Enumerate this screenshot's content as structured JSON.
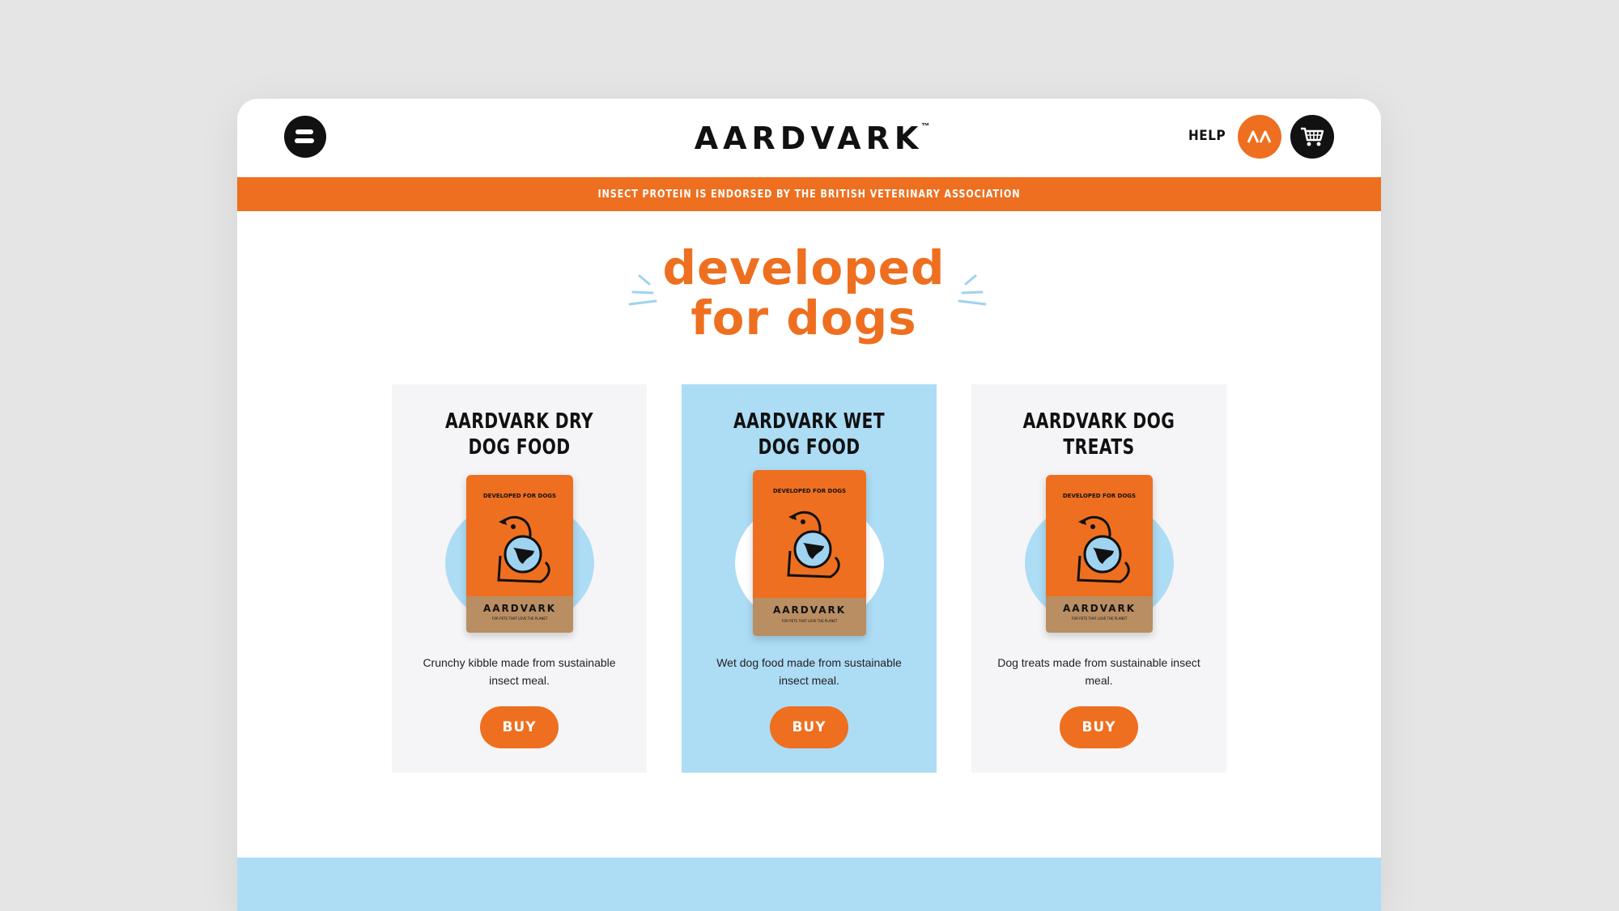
{
  "header": {
    "brand": "AARDVARK",
    "brand_tm": "™",
    "help_label": "HELP",
    "account_initials": "ΛΛ"
  },
  "banner": {
    "text": "INSECT PROTEIN IS ENDORSED BY THE BRITISH VETERINARY ASSOCIATION"
  },
  "hero": {
    "line1": "developed",
    "line2": "for dogs"
  },
  "products": [
    {
      "title_line1": "AARDVARK DRY",
      "title_line2": "DOG FOOD",
      "description": "Crunchy kibble made from sustainable insect meal.",
      "buy_label": "BUY",
      "bag": {
        "label": "DEVELOPED FOR DOGS",
        "brand": "AARDVARK",
        "sub": "FOR PETS THAT LOVE THE PLANET"
      }
    },
    {
      "title_line1": "AARDVARK WET",
      "title_line2": "DOG FOOD",
      "description": "Wet dog food made from sustainable insect meal.",
      "buy_label": "BUY",
      "bag": {
        "label": "DEVELOPED FOR DOGS",
        "brand": "AARDVARK",
        "sub": "FOR PETS THAT LOVE THE PLANET"
      }
    },
    {
      "title_line1": "AARDVARK DOG",
      "title_line2": "TREATS",
      "description": "Dog treats made from sustainable insect meal.",
      "buy_label": "BUY",
      "bag": {
        "label": "DEVELOPED FOR DOGS",
        "brand": "AARDVARK",
        "sub": "FOR PETS THAT LOVE THE PLANET"
      }
    }
  ],
  "colors": {
    "accent": "#ee6f1f",
    "light_blue": "#addcf5",
    "dark": "#111111",
    "card_bg": "#f5f5f7",
    "page_bg": "#e5e5e6"
  },
  "icons": {
    "menu": "menu-icon",
    "account": "account-icon",
    "cart": "cart-icon"
  }
}
